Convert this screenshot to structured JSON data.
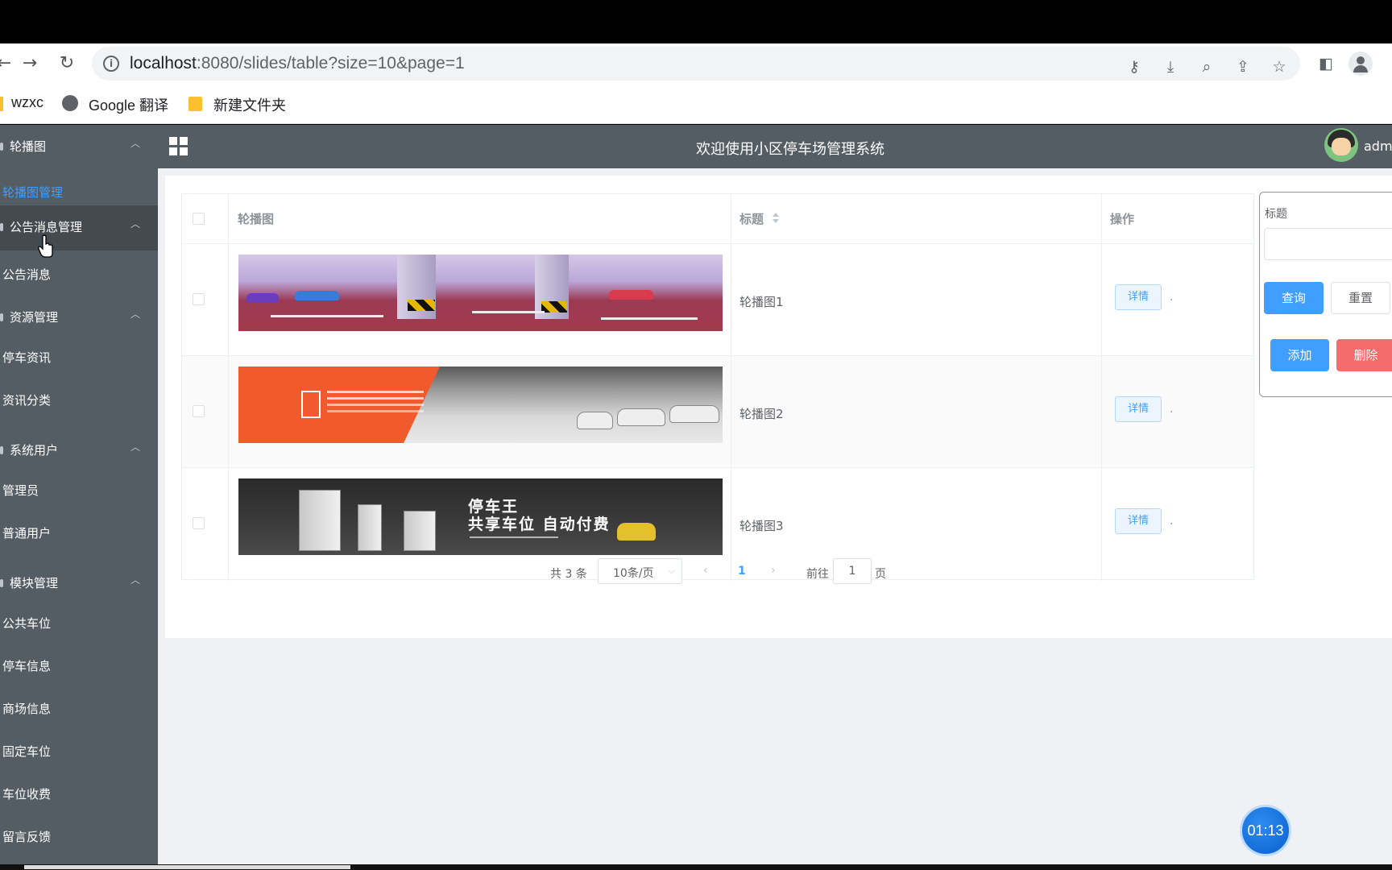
{
  "browser": {
    "url_host": "localhost",
    "url_rest": ":8080/slides/table?size=10&page=1",
    "bookmarks": [
      "wzxc",
      "Google 翻译",
      "新建文件夹"
    ]
  },
  "app": {
    "title": "欢迎使用小区停车场管理系统",
    "user": "admin"
  },
  "sidebar": {
    "groups": [
      {
        "label": "轮播图",
        "items": [
          "轮播图管理"
        ]
      },
      {
        "label": "公告消息管理",
        "items": [
          "公告消息"
        ]
      },
      {
        "label": "资源管理",
        "items": [
          "停车资讯",
          "资讯分类"
        ]
      },
      {
        "label": "系统用户",
        "items": [
          "管理员",
          "普通用户"
        ]
      },
      {
        "label": "模块管理",
        "items": [
          "公共车位",
          "停车信息",
          "商场信息",
          "固定车位",
          "车位收费",
          "留言反馈"
        ]
      }
    ],
    "active_item": "轮播图管理",
    "hovered_group": "公告消息管理"
  },
  "table": {
    "columns": [
      "轮播图",
      "标题",
      "操作"
    ],
    "rows": [
      {
        "title": "轮播图1",
        "action": "详情"
      },
      {
        "title": "轮播图2",
        "action": "详情"
      },
      {
        "title": "轮播图3",
        "action": "详情"
      }
    ],
    "banner3_line1": "停车王",
    "banner3_line2": "共享车位 自动付费"
  },
  "pager": {
    "total": "共 3 条",
    "page_size": "10条/页",
    "prev": "‹",
    "current_page": "1",
    "next": "›",
    "goto_prefix": "前往",
    "goto_value": "1",
    "goto_suffix": "页"
  },
  "search": {
    "label": "标题",
    "query_button": "查询",
    "reset_button": "重置",
    "add_button": "添加",
    "delete_button": "删除"
  },
  "timer": "01:13",
  "colors": {
    "sidebar": "#545c64",
    "primary": "#409eff",
    "danger": "#f56c6c"
  }
}
